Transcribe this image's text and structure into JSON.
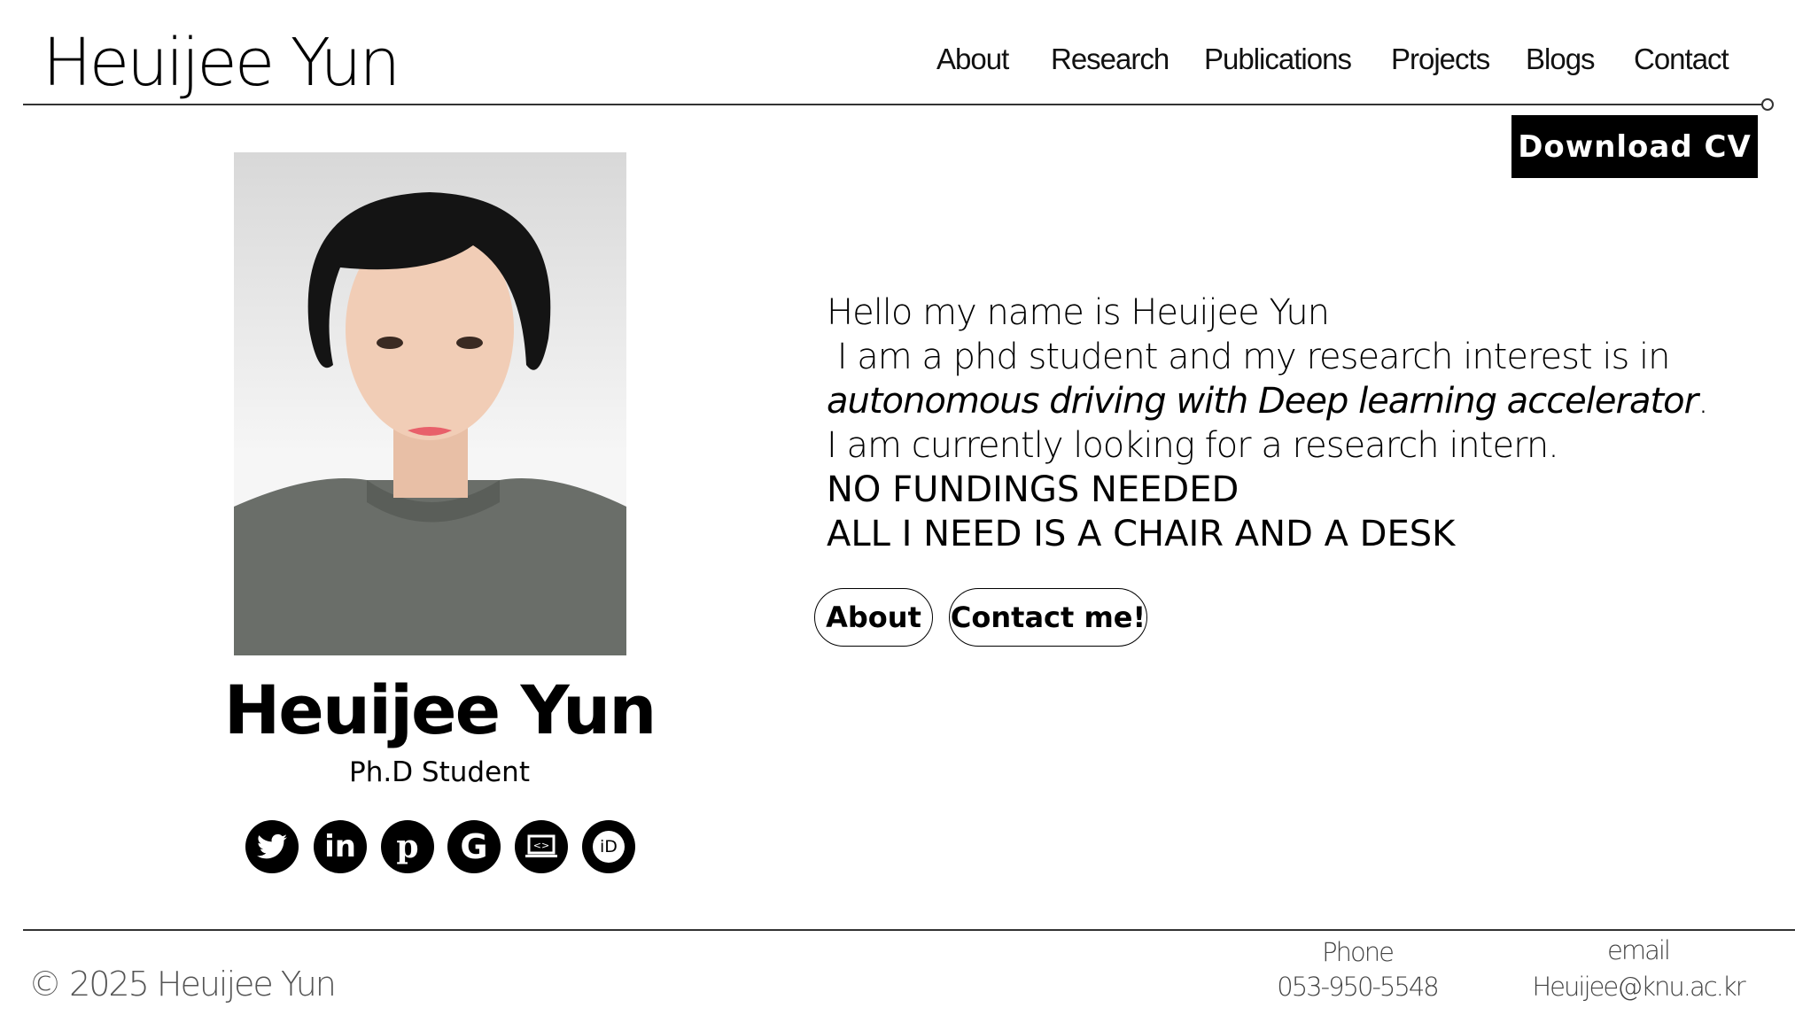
{
  "header": {
    "logo": "Heuijee Yun",
    "nav": [
      "About",
      "Research",
      "Publications",
      "Projects",
      "Blogs",
      "Contact"
    ],
    "download_cv": "Download CV"
  },
  "profile": {
    "name": "Heuijee Yun",
    "role": "Ph.D Student",
    "social": [
      "twitter-icon",
      "linkedin-icon",
      "pinterest-icon",
      "google-scholar-icon",
      "github-code-icon",
      "orcid-icon"
    ]
  },
  "intro": {
    "line1": "Hello my name is Heuijee Yun",
    "line2": " I am a phd student and my research interest is in",
    "line3_italic": "autonomous driving with Deep learning accelerator",
    "line3_end": ".",
    "line4": "I am currently looking for a research intern.",
    "line5": "NO FUNDINGS NEEDED",
    "line6": "ALL I NEED IS A CHAIR AND A DESK"
  },
  "buttons": {
    "about": "About",
    "contact": "Contact me!"
  },
  "footer": {
    "copyright": "© 2025 Heuijee Yun",
    "phone_label": "Phone",
    "phone": "053-950-5548",
    "email_label": "email",
    "email": "Heuijee@knu.ac.kr"
  }
}
